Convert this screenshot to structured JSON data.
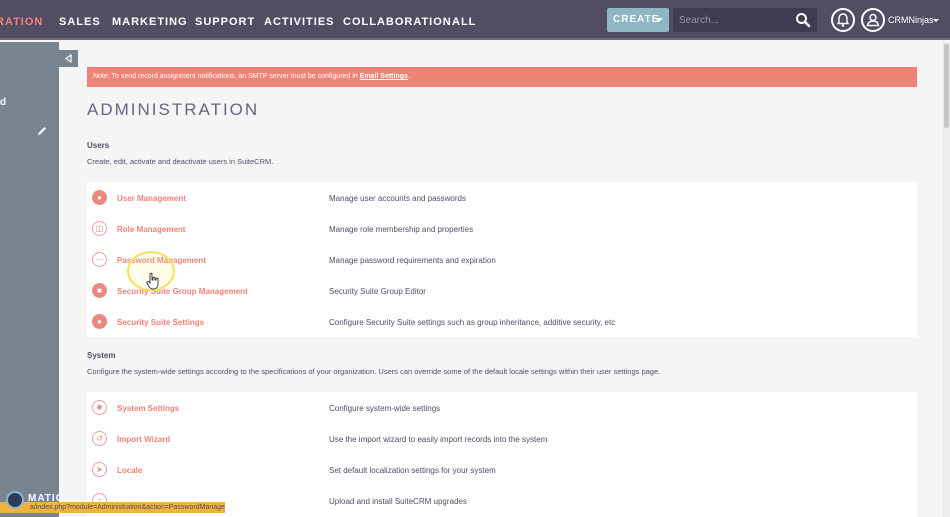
{
  "nav": {
    "items": [
      {
        "label": "RATION",
        "active": true
      },
      {
        "label": "SALES"
      },
      {
        "label": "MARKETING"
      },
      {
        "label": "SUPPORT"
      },
      {
        "label": "ACTIVITIES"
      },
      {
        "label": "COLLABORATION"
      },
      {
        "label": "ALL"
      }
    ],
    "create_label": "CREATE",
    "search_placeholder": "Search...",
    "user_name": "CRMNinjas"
  },
  "sidebar": {
    "visible_letter": "d"
  },
  "alert": {
    "text": "Note: To send record assignment notifications, an SMTP server must be configured in ",
    "link": "Email Settings",
    "suffix": "."
  },
  "page": {
    "title": "ADMINISTRATION"
  },
  "users_section": {
    "title": "Users",
    "description": "Create, edit, activate and deactivate users in SuiteCRM.",
    "rows": [
      {
        "label": "User Management",
        "description": "Manage user accounts and passwords",
        "icon": "user-icon"
      },
      {
        "label": "Role Management",
        "description": "Manage role membership and properties",
        "icon": "role-icon"
      },
      {
        "label": "Password Management",
        "description": "Manage password requirements and expiration",
        "icon": "password-icon"
      },
      {
        "label": "Security Suite Group Management",
        "description": "Security Suite Group Editor",
        "icon": "lock-icon"
      },
      {
        "label": "Security Suite Settings",
        "description": "Configure Security Suite settings such as group inheritance, additive security, etc",
        "icon": "security-settings-icon"
      }
    ]
  },
  "system_section": {
    "title": "System",
    "description": "Configure the system-wide settings according to the specifications of your organization. Users can override some of the default locale settings within their user settings page.",
    "rows": [
      {
        "label": "System Settings",
        "description": "Configure system-wide settings",
        "icon": "gear-icon"
      },
      {
        "label": "Import Wizard",
        "description": "Use the import wizard to easily import records into the system",
        "icon": "import-icon"
      },
      {
        "label": "Locale",
        "description": "Set default localization settings for your system",
        "icon": "locale-icon"
      },
      {
        "label": "",
        "description": "Upload and install SuiteCRM upgrades",
        "icon": "upgrade-icon"
      }
    ]
  },
  "status_bar": {
    "url": "a/index.php?module=Administration&action=PasswordManager"
  },
  "watermark": {
    "text": "MATIC"
  },
  "colors": {
    "navbar": "#534d64",
    "accent": "#f08377",
    "sidebar": "#778591",
    "create_button": "#8eb7c3",
    "status_bar": "#f2b23e"
  }
}
